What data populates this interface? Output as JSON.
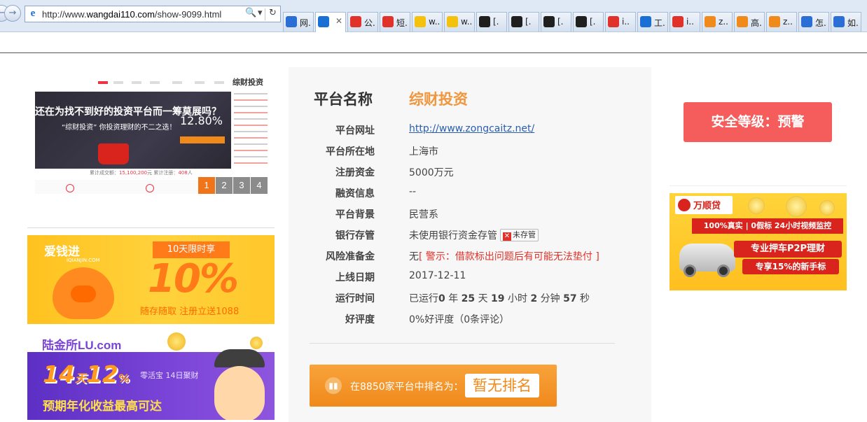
{
  "browser": {
    "url_prefix": "http://www.",
    "url_domain": "wangdai110.com",
    "url_path": "/show-9099.html",
    "search_icon": "🔍",
    "dropdown_icon": "▾",
    "refresh_icon": "↻",
    "back_icon": "←",
    "forward_icon": "→",
    "close_tab_icon": "✕",
    "tabs": [
      {
        "label": "网.",
        "icon": "paw-icon",
        "color": "#2b6fd6"
      },
      {
        "label": "",
        "icon": "ie-icon",
        "color": "#1a6fd4",
        "active": true
      },
      {
        "label": "公.",
        "icon": "swirl-icon",
        "color": "#e0322a"
      },
      {
        "label": "短.",
        "icon": "swirl-icon",
        "color": "#e0322a"
      },
      {
        "label": "w..",
        "icon": "plus-circle-icon",
        "color": "#f4c20d"
      },
      {
        "label": "w..",
        "icon": "plus-circle-icon",
        "color": "#f4c20d"
      },
      {
        "label": "[.",
        "icon": "eye-icon",
        "color": "#1f1f1f"
      },
      {
        "label": "[.",
        "icon": "eye-icon",
        "color": "#1f1f1f"
      },
      {
        "label": "[.",
        "icon": "eye-icon",
        "color": "#1f1f1f"
      },
      {
        "label": "[.",
        "icon": "eye-icon",
        "color": "#1f1f1f"
      },
      {
        "label": "i..",
        "icon": "s-circle-icon",
        "color": "#e0322a"
      },
      {
        "label": "工.",
        "icon": "ie-icon",
        "color": "#1a6fd4"
      },
      {
        "label": "i..",
        "icon": "s-circle-icon",
        "color": "#e0322a"
      },
      {
        "label": "z..",
        "icon": "icp-icon",
        "color": "#f08a1a"
      },
      {
        "label": "高.",
        "icon": "icp-icon",
        "color": "#f08a1a"
      },
      {
        "label": "z..",
        "icon": "icp-icon",
        "color": "#f08a1a"
      },
      {
        "label": "怎.",
        "icon": "paw-icon",
        "color": "#2b6fd6"
      },
      {
        "label": "如.",
        "icon": "paw-icon",
        "color": "#2b6fd6"
      }
    ]
  },
  "left": {
    "screenshot": {
      "logo": "综财投资",
      "hero_text": "还在为找不到好的投资平台而一筹莫展吗？",
      "hero_sub": "“综财投资” 你投资理财的不二之选！",
      "rate": "12.80%",
      "stat_prefix": "累计成交额：",
      "stat_value": "15,100,200",
      "stat_suffix": "元",
      "stat2_prefix": "  累计注册：",
      "stat2_value": "408",
      "stat2_suffix": "人"
    },
    "pager": [
      "1",
      "2",
      "3",
      "4"
    ],
    "ad1": {
      "brand": "爱钱进",
      "brand_sub": "IQIANJIN.COM",
      "tag": "10天限时享",
      "big": "10%",
      "promo": "随存随取 注册立送1088"
    },
    "ad2": {
      "brand": "陆金所LU.com",
      "rate_a": "14",
      "rate_unit": "天",
      "rate_b": "12",
      "rate_pct": "%",
      "product": "零活宝  14日聚财",
      "slogan": "预期年化收益最高可达"
    }
  },
  "platform": {
    "name_label": "平台名称",
    "name_value": "综财投资",
    "rows": [
      {
        "key": "平台网址",
        "value": "http://www.zongcaitz.net/",
        "type": "link"
      },
      {
        "key": "平台所在地",
        "value": "上海市"
      },
      {
        "key": "注册资金",
        "value": "5000万元"
      },
      {
        "key": "融资信息",
        "value": "--"
      },
      {
        "key": "平台背景",
        "value": "民营系"
      },
      {
        "key": "银行存管",
        "value": "未使用银行资金存管",
        "badge": "未存管",
        "badge_icon": "✕"
      },
      {
        "key": "风险准备金",
        "value": "无",
        "warning": "[ 警示：借款标出问题后有可能无法垫付 ]"
      },
      {
        "key": "上线日期",
        "value": "2017-12-11"
      },
      {
        "key": "运行时间",
        "type": "runtime"
      },
      {
        "key": "好评度",
        "value": "0%好评度（0条评论）"
      }
    ],
    "runtime": {
      "prefix": "已运行",
      "years": "0",
      "years_unit": " 年 ",
      "days": "25",
      "days_unit": " 天 ",
      "hours": "19",
      "hours_unit": " 小时 ",
      "minutes": "2",
      "minutes_unit": " 分钟 ",
      "seconds": "57",
      "seconds_unit": " 秒"
    },
    "rank": {
      "text": "在8850家平台中排名为：",
      "value": "暂无排名"
    }
  },
  "right": {
    "safety": "安全等级：预警",
    "ad3": {
      "brand": "万顺贷",
      "strip": "100%真实 | 0假标  24小时视频监控",
      "line1": "专业押车P2P理财",
      "line2": "专享15%的新手标"
    }
  }
}
